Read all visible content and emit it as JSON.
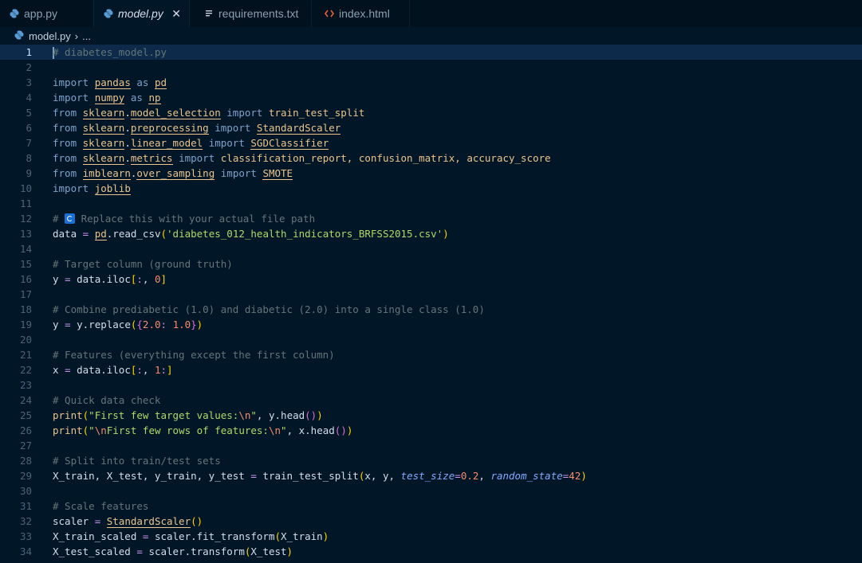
{
  "tabs": [
    {
      "label": "app.py",
      "icon": "python-icon",
      "active": false
    },
    {
      "label": "model.py",
      "icon": "python-icon",
      "active": true,
      "close": "✕"
    },
    {
      "label": "requirements.txt",
      "icon": "text-file-icon",
      "active": false
    },
    {
      "label": "index.html",
      "icon": "html-icon",
      "active": false
    }
  ],
  "breadcrumb": {
    "file": "model.py",
    "separator": "›",
    "rest": "..."
  },
  "code": {
    "l1": "# diabetes_model.py",
    "l3": [
      "import",
      "pandas",
      "as",
      "pd"
    ],
    "l4": [
      "import",
      "numpy",
      "as",
      "np"
    ],
    "l5": [
      "from",
      "sklearn",
      ".",
      "model_selection",
      "import",
      "train_test_split"
    ],
    "l6": [
      "from",
      "sklearn",
      ".",
      "preprocessing",
      "import",
      "StandardScaler"
    ],
    "l7": [
      "from",
      "sklearn",
      ".",
      "linear_model",
      "import",
      "SGDClassifier"
    ],
    "l8": [
      "from",
      "sklearn",
      ".",
      "metrics",
      "import",
      "classification_report, confusion_matrix, accuracy_score"
    ],
    "l9": [
      "from",
      "imblearn",
      ".",
      "over_sampling",
      "import",
      "SMOTE"
    ],
    "l10": [
      "import",
      "joblib"
    ],
    "l12": [
      "#",
      "Replace this with your actual file path"
    ],
    "l13": [
      "data",
      "=",
      "pd",
      ".read_csv",
      "(",
      "'diabetes_012_health_indicators_BRFSS2015.csv'",
      ")"
    ],
    "l15": "# Target column (ground truth)",
    "l16": [
      "y",
      "=",
      "data.iloc",
      "[",
      ":",
      ",",
      "0",
      "]"
    ],
    "l18": "# Combine prediabetic (1.0) and diabetic (2.0) into a single class (1.0)",
    "l19": [
      "y",
      "=",
      "y.replace",
      "(",
      "{",
      "2.0",
      ":",
      "1.0",
      "}",
      ")"
    ],
    "l21": "# Features (everything except the first column)",
    "l22": [
      "x",
      "=",
      "data.iloc",
      "[",
      ":",
      ",",
      "1",
      ":",
      "]"
    ],
    "l24": "# Quick data check",
    "l25": [
      "print",
      "(",
      "\"First few target values:",
      "\\n",
      "\"",
      ", ",
      "y",
      ".head",
      "()",
      ")"
    ],
    "l26": [
      "print",
      "(",
      "\"",
      "\\n",
      "First few rows of features:",
      "\\n",
      "\"",
      ", ",
      "x",
      ".head",
      "()",
      ")"
    ],
    "l28": "# Split into train/test sets",
    "l29": [
      "X_train, X_test, y_train, y_test",
      "=",
      "train_test_split",
      "(",
      "x, y,",
      "test_size",
      "=",
      "0.2",
      ",",
      "random_state",
      "=",
      "42",
      ")"
    ],
    "l31": "# Scale features",
    "l32": [
      "scaler",
      "=",
      "StandardScaler",
      "()"
    ],
    "l33": [
      "X_train_scaled",
      "=",
      "scaler",
      ".fit_transform",
      "(",
      "X_train",
      ")"
    ],
    "l34": [
      "X_test_scaled",
      "=",
      "scaler",
      ".transform",
      "(",
      "X_test",
      ")"
    ]
  },
  "colors": {
    "background": "#011627",
    "tabbar": "#01111d",
    "current_line": "#0e2a4a"
  }
}
